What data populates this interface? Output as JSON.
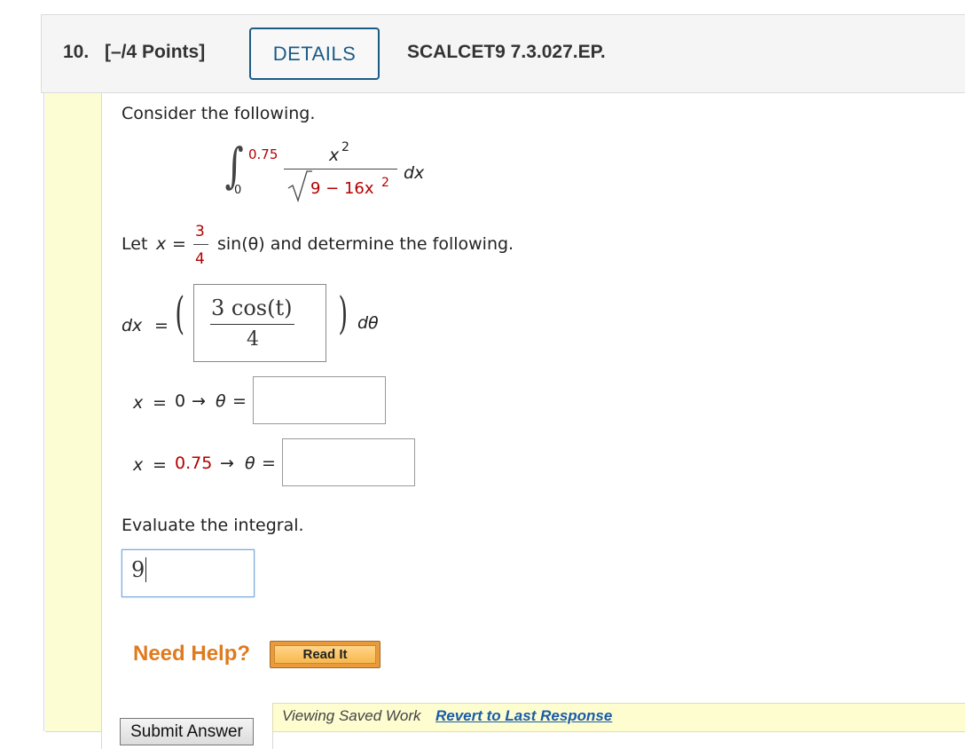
{
  "header": {
    "question_number": "10.",
    "points": "[–/4 Points]",
    "details_label": "DETAILS",
    "question_code": "SCALCET9 7.3.027.EP."
  },
  "problem": {
    "intro": "Consider the following.",
    "integral": {
      "upper_limit": "0.75",
      "lower_limit": "0",
      "numerator_var": "x",
      "numerator_exp": "2",
      "denominator": "9 − 16x",
      "denominator_exp": "2",
      "differential": "dx"
    },
    "substitution": {
      "prefix": "Let",
      "var": "x",
      "eq": "=",
      "frac_num": "3",
      "frac_den": "4",
      "suffix": "sin(θ) and determine the following."
    }
  },
  "dx_row": {
    "label": "dx",
    "eq": "=",
    "answer_numerator": "3 cos(t)",
    "answer_denominator": "4",
    "dtheta": "dθ"
  },
  "limits": [
    {
      "x": "x",
      "eq": "=",
      "value": "0",
      "arrow": "→",
      "theta": "θ",
      "eq2": "=",
      "answer": ""
    },
    {
      "x": "x",
      "eq": "=",
      "value": "0.75",
      "arrow": "→",
      "theta": "θ",
      "eq2": "=",
      "answer": ""
    }
  ],
  "evaluate": {
    "prompt": "Evaluate the integral.",
    "value": "9"
  },
  "help": {
    "label": "Need Help?",
    "read_it": "Read It"
  },
  "footer": {
    "submit": "Submit Answer",
    "saved_text": "Viewing Saved Work",
    "revert_link": "Revert to Last Response"
  },
  "colors": {
    "accent_blue": "#1b5c87",
    "value_red": "#b30000",
    "help_orange": "#e07a1f",
    "yellow_band": "#fdfdd3"
  }
}
